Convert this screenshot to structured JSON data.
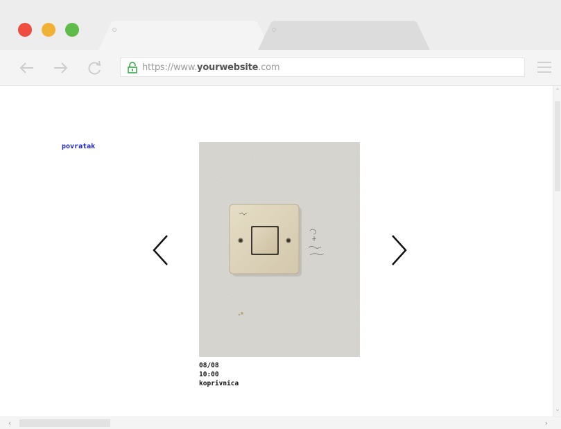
{
  "browser": {
    "tabs": [
      {
        "label": ""
      },
      {
        "label": ""
      }
    ],
    "address": {
      "prefix": "https://www.",
      "domain": "yourwebsite",
      "suffix": ".com"
    },
    "icons": {
      "back": "back-arrow-icon",
      "forward": "forward-arrow-icon",
      "reload": "reload-icon",
      "lock": "lock-icon",
      "menu": "hamburger-menu-icon"
    },
    "colors": {
      "close": "#ee4d3f",
      "minimize": "#f1b135",
      "maximize": "#5fbb4a",
      "link": "#1a23c8"
    }
  },
  "page": {
    "back_link": "povratak",
    "prev_icon": "chevron-left-icon",
    "next_icon": "chevron-right-icon",
    "photo": "light-switch-on-white-wall",
    "caption": {
      "date": "08/08",
      "time": "10:00",
      "place": "koprivnica"
    }
  }
}
